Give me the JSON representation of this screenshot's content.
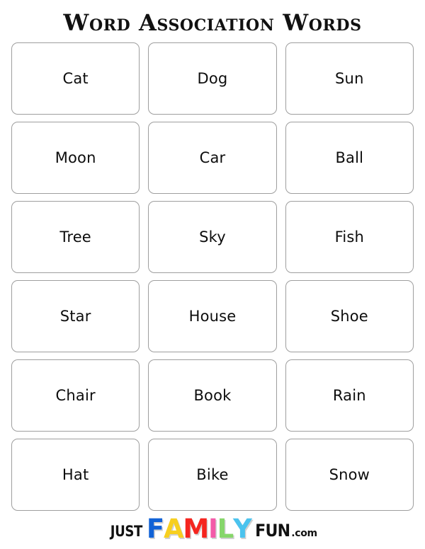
{
  "header": {
    "title": "Word Association Words"
  },
  "grid": {
    "columns": 3,
    "rows": 6,
    "cards": [
      {
        "label": "Cat"
      },
      {
        "label": "Dog"
      },
      {
        "label": "Sun"
      },
      {
        "label": "Moon"
      },
      {
        "label": "Car"
      },
      {
        "label": "Ball"
      },
      {
        "label": "Tree"
      },
      {
        "label": "Sky"
      },
      {
        "label": "Fish"
      },
      {
        "label": "Star"
      },
      {
        "label": "House"
      },
      {
        "label": "Shoe"
      },
      {
        "label": "Chair"
      },
      {
        "label": "Book"
      },
      {
        "label": "Rain"
      },
      {
        "label": "Hat"
      },
      {
        "label": "Bike"
      },
      {
        "label": "Snow"
      }
    ]
  },
  "footer": {
    "logo": {
      "just": "JUST",
      "family_letters": [
        {
          "char": "F",
          "color": "#1162d6"
        },
        {
          "char": "A",
          "color": "#f7cf1f"
        },
        {
          "char": "M",
          "color": "#f5251f"
        },
        {
          "char": "I",
          "color": "#f35aa8"
        },
        {
          "char": "L",
          "color": "#86d66a"
        },
        {
          "char": "Y",
          "color": "#4bc3ee"
        }
      ],
      "fun": "FUN",
      "com": ".com"
    }
  },
  "colors": {
    "background": "#ffffff",
    "card_border": "#9e9e9e",
    "text": "#0d0d0d",
    "title": "#111111"
  }
}
